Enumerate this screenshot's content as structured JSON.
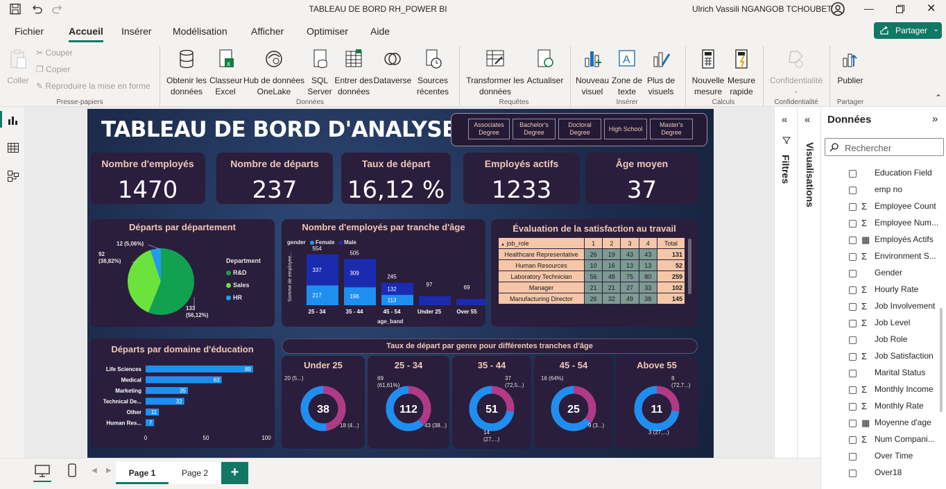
{
  "window": {
    "title": "TABLEAU DE BORD RH_POWER BI",
    "user": "Ulrich Vassili NGANGOB TCHOUBET"
  },
  "menu": [
    "Fichier",
    "Accueil",
    "Insérer",
    "Modélisation",
    "Afficher",
    "Optimiser",
    "Aide"
  ],
  "share_label": "Partager",
  "ribbon": {
    "clipboard": {
      "paste": "Coller",
      "cut": "Couper",
      "copy": "Copier",
      "format": "Reproduire la mise en forme",
      "group": "Presse-papiers"
    },
    "data": {
      "get_data": "Obtenir les données",
      "excel": "Classeur Excel",
      "onelake": "Hub de données OneLake",
      "sql": "SQL Server",
      "enter": "Entrer des données",
      "dataverse": "Dataverse",
      "recent": "Sources récentes",
      "group": "Données"
    },
    "queries": {
      "transform": "Transformer les données",
      "refresh": "Actualiser",
      "group": "Requêtes"
    },
    "insert": {
      "visual": "Nouveau visuel",
      "textbox": "Zone de texte",
      "more": "Plus de visuels",
      "group": "Insérer"
    },
    "calc": {
      "measure": "Nouvelle mesure",
      "quick": "Mesure rapide",
      "group": "Calculs"
    },
    "privacy": {
      "label": "Confidentialité",
      "group": "Confidentialité"
    },
    "share": {
      "publish": "Publier",
      "group": "Partager"
    }
  },
  "report": {
    "title": "TABLEAU DE BORD D'ANALYSE RH",
    "slicer": [
      "Associates Degree",
      "Bachelor's Degree",
      "Doctoral Degree",
      "High School",
      "Master's Degree"
    ],
    "kpis": [
      {
        "label": "Nombre d'employés",
        "value": "1470"
      },
      {
        "label": "Nombre de départs",
        "value": "237"
      },
      {
        "label": "Taux de départ",
        "value": "16,12 %"
      },
      {
        "label": "Employés actifs",
        "value": "1233"
      },
      {
        "label": "Âge moyen",
        "value": "37"
      }
    ],
    "pie": {
      "title": "Départs par département",
      "legend_title": "Department",
      "slices": [
        {
          "name": "R&D",
          "value": 133,
          "label": "133 (56,12%)",
          "color": "#12a150"
        },
        {
          "name": "Sales",
          "value": 92,
          "label": "92 (38,82%)",
          "color": "#6be33c"
        },
        {
          "name": "HR",
          "value": 12,
          "label": "12 (5,06%)",
          "color": "#1e9cf0"
        }
      ]
    },
    "age_chart": {
      "title": "Nombre d'employés par tranche d'âge",
      "legend_title": "gender",
      "series_names": [
        "Female",
        "Male"
      ],
      "ylabel": "Somme de employee...",
      "xlabel": "age_band",
      "categories": [
        "25 - 34",
        "35 - 44",
        "45 - 54",
        "Under 25",
        "Over 55"
      ],
      "totals": [
        554,
        505,
        245,
        97,
        69
      ],
      "female": [
        217,
        196,
        113,
        null,
        null
      ],
      "male": [
        337,
        309,
        132,
        null,
        null
      ]
    },
    "satisfaction": {
      "title": "Évaluation de la satisfaction au travail",
      "header": [
        "job_role",
        "1",
        "2",
        "3",
        "4",
        "Total"
      ],
      "rows": [
        [
          "Healthcare Representative",
          "26",
          "19",
          "43",
          "43",
          "131"
        ],
        [
          "Human Resources",
          "10",
          "16",
          "13",
          "13",
          "52"
        ],
        [
          "Laboratory Technician",
          "56",
          "48",
          "75",
          "80",
          "259"
        ],
        [
          "Manager",
          "21",
          "21",
          "27",
          "33",
          "102"
        ],
        [
          "Manufacturing Director",
          "26",
          "32",
          "49",
          "38",
          "145"
        ]
      ]
    },
    "edu_chart": {
      "title": "Départs par domaine d'éducation",
      "categories": [
        "Life Sciences",
        "Medical",
        "Marketing",
        "Technical De...",
        "Other",
        "Human Res..."
      ],
      "values": [
        89,
        63,
        35,
        32,
        11,
        7
      ],
      "ticks": [
        "0",
        "50",
        "100"
      ]
    },
    "gender_rate": {
      "title": "Taux de départ par genre pour différentes tranches d'âge",
      "donuts": [
        {
          "label": "Under 25",
          "total": "38",
          "a": 20,
          "b": 18,
          "la": "20 (5...)",
          "lb": "18 (4...)"
        },
        {
          "label": "25 - 34",
          "total": "112",
          "a": 69,
          "b": 43,
          "la": "69 (61,61%)",
          "lb": "43 (38...)"
        },
        {
          "label": "35 - 44",
          "total": "51",
          "a": 37,
          "b": 14,
          "la": "37 (72,5...)",
          "lb": "14 (27,...)"
        },
        {
          "label": "45 - 54",
          "total": "25",
          "a": 16,
          "b": 9,
          "la": "16 (64%)",
          "lb": "9 (3...)"
        },
        {
          "label": "Above 55",
          "total": "11",
          "a": 8,
          "b": 3,
          "la": "8 (72,7...)",
          "lb": "3 (27,...)"
        }
      ]
    }
  },
  "panes": {
    "filters": "Filtres",
    "visualizations": "Visualisations",
    "data": "Données",
    "search_placeholder": "Rechercher"
  },
  "fields": [
    {
      "name": "Education Field",
      "sigma": false
    },
    {
      "name": "emp no",
      "sigma": false
    },
    {
      "name": "Employee Count",
      "sigma": true
    },
    {
      "name": "Employee Num...",
      "sigma": true
    },
    {
      "name": "Employés Actifs",
      "sigma": false,
      "calc": true
    },
    {
      "name": "Environment S...",
      "sigma": true
    },
    {
      "name": "Gender",
      "sigma": false
    },
    {
      "name": "Hourly Rate",
      "sigma": true
    },
    {
      "name": "Job Involvement",
      "sigma": true
    },
    {
      "name": "Job Level",
      "sigma": true
    },
    {
      "name": "Job Role",
      "sigma": false
    },
    {
      "name": "Job Satisfaction",
      "sigma": true
    },
    {
      "name": "Marital Status",
      "sigma": false
    },
    {
      "name": "Monthly Income",
      "sigma": true
    },
    {
      "name": "Monthly Rate",
      "sigma": true
    },
    {
      "name": "Moyenne d'age",
      "sigma": false,
      "calc": true
    },
    {
      "name": "Num Compani...",
      "sigma": true
    },
    {
      "name": "Over Time",
      "sigma": false
    },
    {
      "name": "Over18",
      "sigma": false
    }
  ],
  "pages": [
    "Page 1",
    "Page 2"
  ]
}
